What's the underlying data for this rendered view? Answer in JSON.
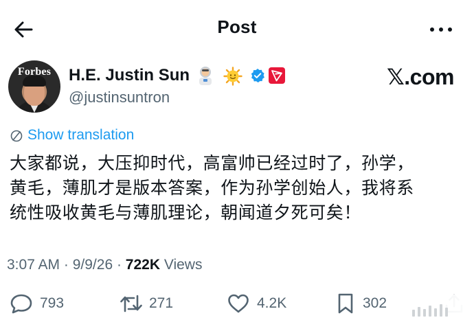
{
  "header": {
    "title": "Post",
    "back_icon": "arrow-left-icon",
    "more_icon": "more-horizontal-icon"
  },
  "author": {
    "avatar_text": "Forbes",
    "name": "H.E. Justin Sun",
    "handle": "@justinsuntron",
    "badges": [
      "astronaut-emoji",
      "sun-emoji",
      "verified-badge-icon",
      "tron-logo-icon"
    ],
    "verified_color": "#1d9bf0",
    "tron_color": "#e8183a"
  },
  "brand": {
    "site": "𝕏.com"
  },
  "translation": {
    "label": "Show translation",
    "icon": "globe-icon",
    "color": "#1d9bf0"
  },
  "post": {
    "lines": [
      "大家都说，大压抑时代，高富帅已经过时了，孙学，",
      "黄毛，薄肌才是版本答案，作为孙学创始人，我将系",
      "统性吸收黄毛与薄肌理论，朝闻道夕死可矣！"
    ]
  },
  "meta": {
    "time": "3:07 AM",
    "sep1": " · ",
    "date": "9/9/26",
    "sep2": " · ",
    "views_count": "722K",
    "views_label": " Views"
  },
  "actions": {
    "replies": {
      "icon": "reply-icon",
      "count": "793"
    },
    "reposts": {
      "icon": "repost-icon",
      "count": "271"
    },
    "likes": {
      "icon": "heart-icon",
      "count": "4.2K"
    },
    "bookmarks": {
      "icon": "bookmark-icon",
      "count": "302"
    },
    "share": {
      "icon": "share-icon"
    }
  }
}
